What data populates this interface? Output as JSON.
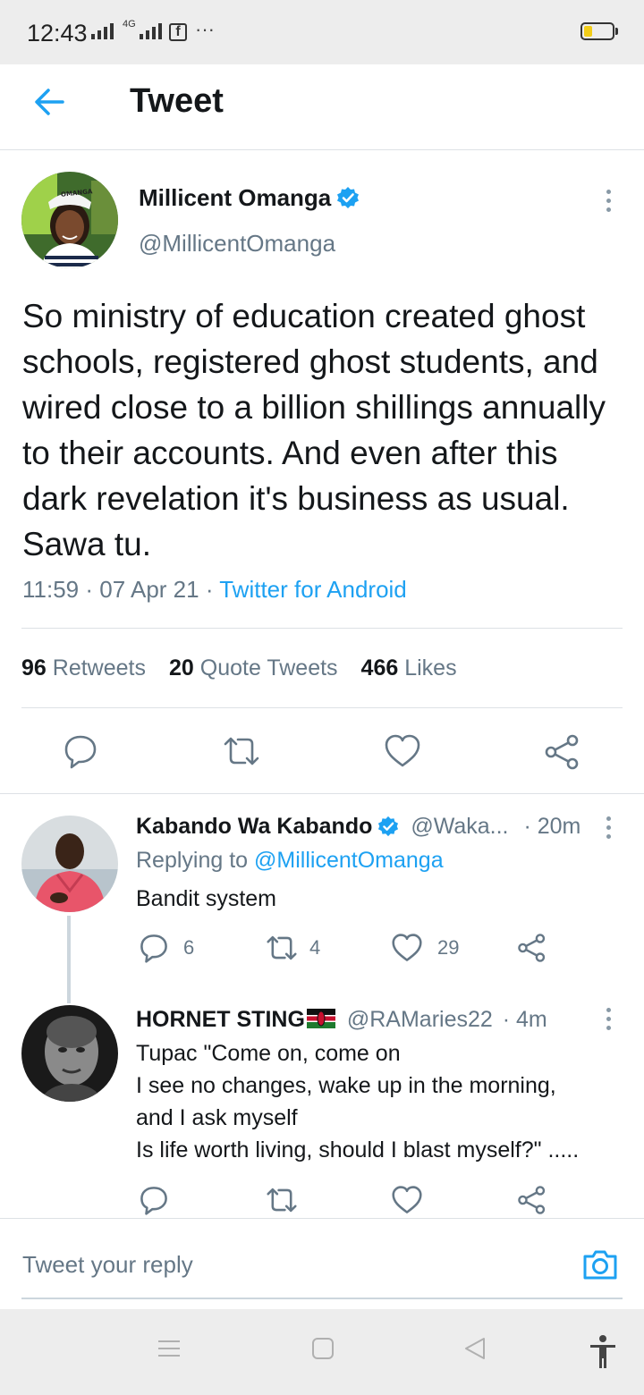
{
  "status_bar": {
    "time": "12:43",
    "network_label": "4G",
    "more": "···",
    "battery_level": 0.3,
    "icons": [
      "signal-icon",
      "signal-4g-icon",
      "facebook-icon",
      "battery-icon"
    ]
  },
  "header": {
    "title": "Tweet",
    "back_icon": "arrow-left-icon"
  },
  "tweet": {
    "author_name": "Millicent Omanga",
    "verified": true,
    "handle": "@MillicentOmanga",
    "avatar_cap_text": "OMANGA",
    "text": "So ministry of education created ghost schools, registered ghost students, and wired close to a billion shillings annually to their accounts. And even after this dark revelation it's business as usual. Sawa tu.",
    "time": "11:59",
    "date": "07 Apr 21",
    "source": "Twitter for Android",
    "stats": {
      "retweets_count": "96",
      "retweets_label": "Retweets",
      "quotes_count": "20",
      "quotes_label": "Quote Tweets",
      "likes_count": "466",
      "likes_label": "Likes"
    },
    "actions": [
      "reply-icon",
      "retweet-icon",
      "like-icon",
      "share-icon"
    ]
  },
  "replies": [
    {
      "name": "Kabando Wa Kabando",
      "verified": true,
      "handle": "@Waka...",
      "time": "· 20m",
      "replying_prefix": "Replying to",
      "replying_to": "@MillicentOmanga",
      "text_lines": [
        "Bandit system"
      ],
      "reply_count": "6",
      "retweet_count": "4",
      "like_count": "29"
    },
    {
      "name": "HORNET STING",
      "flag": "kenya-flag",
      "handle": "@RAMaries22",
      "time": "· 4m",
      "text_lines": [
        "Tupac \"Come on, come on",
        "I see no changes, wake up in the morning,",
        "and I ask myself",
        "Is life worth living, should I blast myself?\" ....."
      ]
    }
  ],
  "composer": {
    "placeholder": "Tweet your reply",
    "camera_icon": "camera-icon"
  },
  "nav_bar": {
    "icons": [
      "menu-icon",
      "home-square-icon",
      "back-triangle-icon",
      "accessibility-icon"
    ]
  },
  "colors": {
    "accent": "#1da1f2",
    "muted_text": "#657786",
    "primary_text": "#14171a",
    "divider": "#dde1e5",
    "system_bar": "#ededed"
  }
}
